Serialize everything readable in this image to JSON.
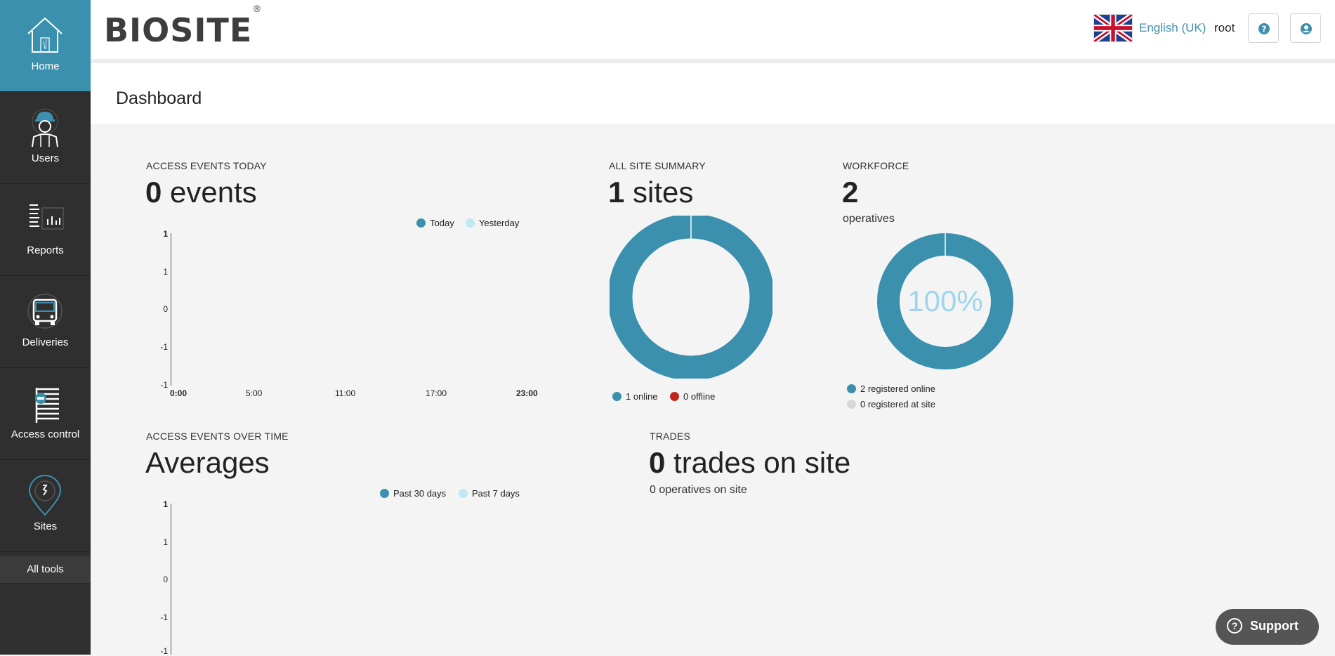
{
  "sidebar": {
    "items": [
      {
        "label": "Home",
        "icon": "home-icon"
      },
      {
        "label": "Users",
        "icon": "worker-icon"
      },
      {
        "label": "Reports",
        "icon": "reports-icon"
      },
      {
        "label": "Deliveries",
        "icon": "truck-icon"
      },
      {
        "label": "Access control",
        "icon": "turnstile-icon"
      },
      {
        "label": "Sites",
        "icon": "map-pin-icon"
      }
    ],
    "all_tools": "All tools",
    "active_color": "#3a90ad"
  },
  "header": {
    "logo": "BIOSITE",
    "logo_mark": "®",
    "language": "English (UK)",
    "user": "root"
  },
  "page": {
    "title": "Dashboard"
  },
  "access_today": {
    "label": "ACCESS EVENTS TODAY",
    "count": "0",
    "unit": " events",
    "legend": [
      "Today",
      "Yesterday"
    ],
    "y_ticks": [
      "1",
      "1",
      "0",
      "-1",
      "-1"
    ],
    "x_ticks": [
      "0:00",
      "5:00",
      "11:00",
      "17:00",
      "23:00"
    ]
  },
  "site_summary": {
    "label": "ALL SITE SUMMARY",
    "count": "1",
    "unit": " sites",
    "legend": [
      "1 online",
      "0 offline"
    ]
  },
  "workforce": {
    "label": "WORKFORCE",
    "count": "2",
    "sub": "operatives",
    "percent": "100%",
    "legend": [
      "2 registered online",
      "0 registered at site"
    ]
  },
  "access_over_time": {
    "label": "ACCESS EVENTS OVER TIME",
    "title": "Averages",
    "legend": [
      "Past 30 days",
      "Past 7 days"
    ],
    "y_ticks": [
      "1",
      "1",
      "0",
      "-1",
      "-1"
    ]
  },
  "trades": {
    "label": "TRADES",
    "count": "0",
    "unit": " trades on site",
    "sub": "0 operatives on site"
  },
  "support": {
    "label": "Support"
  },
  "colors": {
    "primary": "#3a90ad",
    "light": "#bfe8f5",
    "offline": "#c0251d",
    "grey": "#d8d8d8",
    "percent_text": "#9fd6ec"
  },
  "chart_data": [
    {
      "type": "line",
      "categories": [
        "0:00",
        "5:00",
        "11:00",
        "17:00",
        "23:00"
      ],
      "series": [
        {
          "name": "Today",
          "values": []
        },
        {
          "name": "Yesterday",
          "values": []
        }
      ],
      "ylim": [
        -1,
        1
      ],
      "legend": "top-right"
    },
    {
      "type": "pie",
      "categories": [
        "1 online",
        "0 offline"
      ],
      "values": [
        1,
        0
      ],
      "legend": "bottom"
    },
    {
      "type": "pie",
      "categories": [
        "2 registered online",
        "0 registered at site"
      ],
      "values": [
        2,
        0
      ],
      "legend": "bottom"
    },
    {
      "type": "line",
      "series": [
        {
          "name": "Past 30 days",
          "values": []
        },
        {
          "name": "Past 7 days",
          "values": []
        }
      ],
      "ylim": [
        -1,
        1
      ],
      "legend": "top-right"
    }
  ]
}
